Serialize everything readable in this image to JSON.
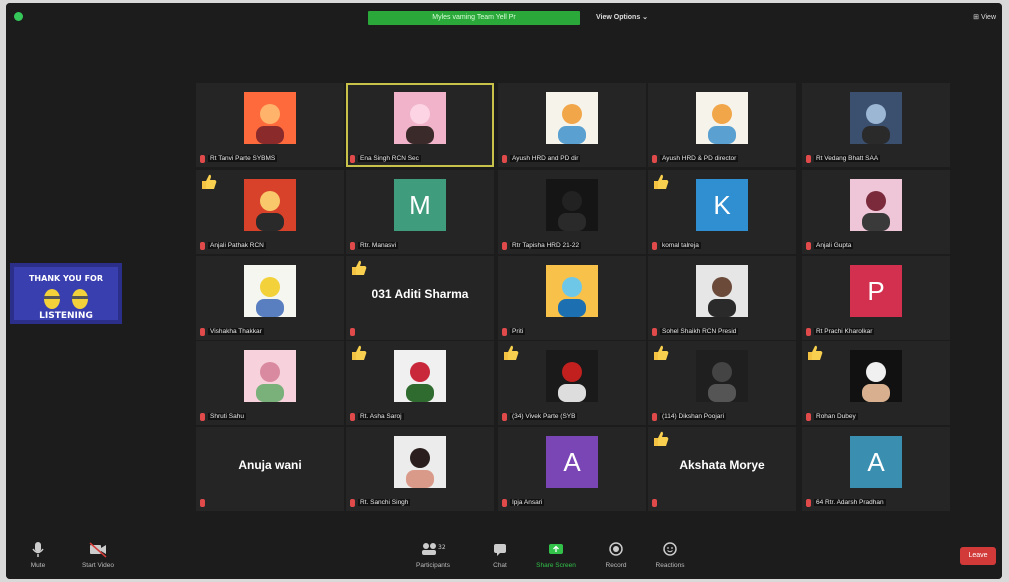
{
  "topbar": {
    "banner": "Myles vaming Team Yell Pr",
    "view_options": "View Options ⌄",
    "view_button": "⊞ View"
  },
  "thanks_card": {
    "line1": "THANK YOU FOR",
    "line2": "LISTENING"
  },
  "participants": [
    {
      "name": "Rt Tanvi Parte SYBMS",
      "kind": "photo",
      "palette": "sunset",
      "hand": false
    },
    {
      "name": "Ena Singh RCN Sec",
      "kind": "photo",
      "palette": "girl",
      "hand": false,
      "active": true
    },
    {
      "name": "Ayush HRD and PD dir",
      "kind": "photo",
      "palette": "cartoon",
      "hand": false
    },
    {
      "name": "Ayush HRD & PD director",
      "kind": "photo",
      "palette": "cartoon",
      "hand": false
    },
    {
      "name": "Rt Vedang Bhatt SAA",
      "kind": "photo",
      "palette": "group",
      "hand": false
    },
    {
      "name": "Anjali Pathak RCN",
      "kind": "photo",
      "palette": "street",
      "hand": true
    },
    {
      "name": "Rtr. Manasvi",
      "kind": "avatar",
      "letter": "M",
      "color": "#3f9c7c",
      "hand": false
    },
    {
      "name": "Rtr Tapisha HRD 21-22",
      "kind": "photo",
      "palette": "dark",
      "hand": false
    },
    {
      "name": "komal talreja",
      "kind": "avatar",
      "letter": "K",
      "color": "#2f8fd0",
      "hand": true
    },
    {
      "name": "Anjali Gupta",
      "kind": "photo",
      "palette": "pink",
      "hand": false
    },
    {
      "name": "Vishakha Thakkar",
      "kind": "photo",
      "palette": "minion",
      "hand": false
    },
    {
      "name": "031 Aditi Sharma",
      "kind": "text",
      "hand": true
    },
    {
      "name": "Priti",
      "kind": "photo",
      "palette": "beach",
      "hand": false
    },
    {
      "name": "Sohel Shaikh RCN Presid",
      "kind": "photo",
      "palette": "man",
      "hand": false
    },
    {
      "name": "Rt Prachi Kharolkar",
      "kind": "avatar",
      "letter": "P",
      "color": "#d3304f",
      "hand": false
    },
    {
      "name": "Shruti Sahu",
      "kind": "photo",
      "palette": "flower",
      "hand": false
    },
    {
      "name": "Rt. Asha Saroj",
      "kind": "photo",
      "palette": "roses",
      "hand": true
    },
    {
      "name": "(34) Vivek Parte (SYB",
      "kind": "photo",
      "palette": "logo",
      "hand": true
    },
    {
      "name": "(114) Dikshan Poojari",
      "kind": "photo",
      "palette": "signature",
      "hand": true
    },
    {
      "name": "Rohan Dubey",
      "kind": "photo",
      "palette": "cap",
      "hand": true
    },
    {
      "name": "Anuja wani",
      "kind": "text",
      "hand": false
    },
    {
      "name": "Rt. Sanchi Singh",
      "kind": "photo",
      "palette": "selfie",
      "hand": false
    },
    {
      "name": "Ipja Ansari",
      "kind": "avatar",
      "letter": "A",
      "color": "#7a45b5",
      "hand": false
    },
    {
      "name": "Akshata Morye",
      "kind": "text",
      "hand": true
    },
    {
      "name": "64 Rtr. Adarsh Pradhan",
      "kind": "avatar",
      "letter": "A",
      "color": "#3a8fb0",
      "hand": false
    }
  ],
  "toolbar": {
    "mute": "Mute",
    "video": "Start Video",
    "participants": "Participants",
    "participants_count": "32",
    "chat": "Chat",
    "share": "Share Screen",
    "record": "Record",
    "reactions": "Reactions",
    "leave": "Leave"
  },
  "colors": {
    "bg": "#1c1c1c",
    "tile": "#252525",
    "active_border": "#c8c24a",
    "share_green": "#32c24a",
    "leave_red": "#d23a3a"
  }
}
